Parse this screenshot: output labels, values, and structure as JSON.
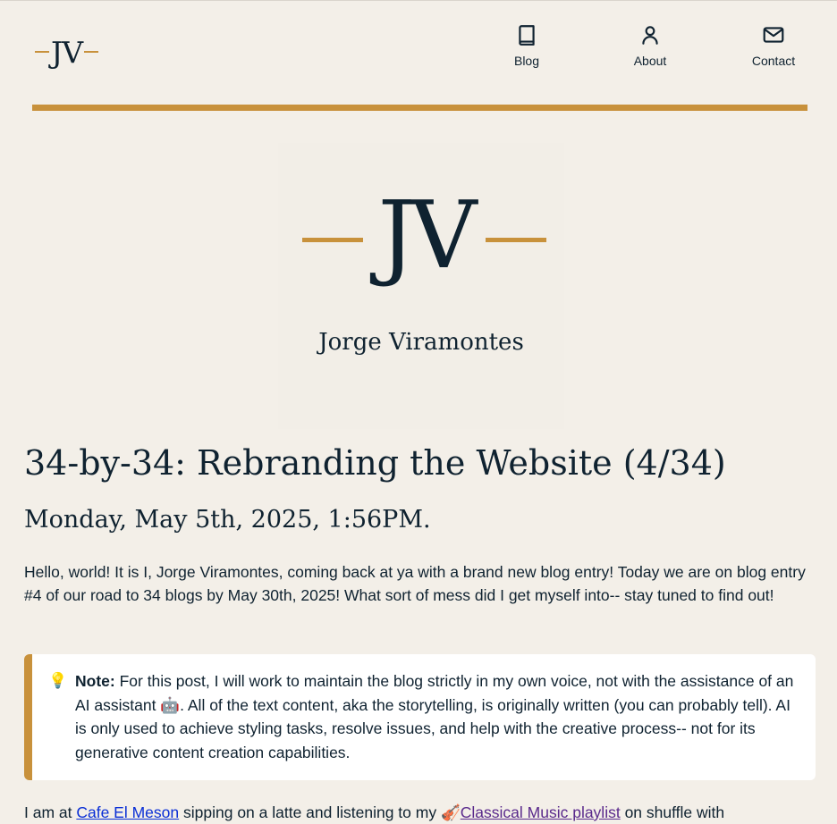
{
  "header": {
    "logo_text": "JV",
    "nav": [
      {
        "label": "Blog",
        "icon": "book-icon"
      },
      {
        "label": "About",
        "icon": "user-icon"
      },
      {
        "label": "Contact",
        "icon": "mail-icon"
      }
    ]
  },
  "hero": {
    "logo_text": "JV",
    "name": "Jorge Viramontes"
  },
  "post": {
    "title": "34-by-34: Rebranding the Website (4/34)",
    "date": "Monday, May 5th, 2025, 1:56PM.",
    "intro": "Hello, world! It is I, Jorge Viramontes, coming back at ya with a brand new blog entry! Today we are on blog entry #4 of our road to 34 blogs by May 30th, 2025! What sort of mess did I get myself into-- stay tuned to find out!",
    "note_icon": "💡",
    "note_label": "Note:",
    "note_text_1": " For this post, I will work to maintain the blog strictly in my own voice, not with the assistance of an AI assistant ",
    "note_emoji": "🤖",
    "note_text_2": ". All of the text content, aka the storytelling, is originally written (you can probably tell). AI is only used to achieve styling tasks, resolve issues, and help with the creative process-- not for its generative content creation capabilities.",
    "bottom_prefix": "I am at ",
    "bottom_link1": "Cafe El Meson",
    "bottom_middle": " sipping on a latte and listening to my ",
    "bottom_emoji": "🎻",
    "bottom_link2": "Classical Music playlist",
    "bottom_suffix": " on shuffle with"
  },
  "colors": {
    "background": "#f3efe8",
    "accent": "#c8913b",
    "text": "#0f2230",
    "link": "#0a2fd6",
    "visited_link": "#5a2a8c"
  }
}
